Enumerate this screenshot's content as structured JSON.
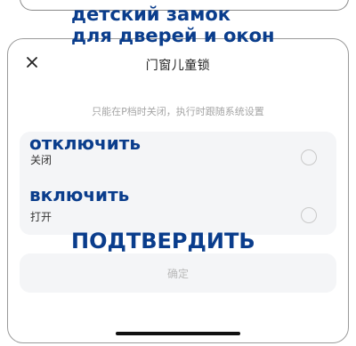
{
  "dialog": {
    "title": "门窗儿童锁",
    "subtitle": "只能在P档时关闭，执行时跟随系统设置",
    "options": [
      {
        "label": "关闭",
        "selected": false
      },
      {
        "label": "打开",
        "selected": false
      }
    ],
    "confirm_label": "确定"
  },
  "annotations": {
    "title_line1": "детский замок",
    "title_line2": "для дверей и окон",
    "off": "отключить",
    "on": "включить",
    "confirm": "ПОДТВЕРДИТЬ"
  },
  "colors": {
    "annotation_text": "#0a3d8c",
    "panel_background": "#f4f5f7",
    "disabled_text": "#b9b9b9"
  }
}
